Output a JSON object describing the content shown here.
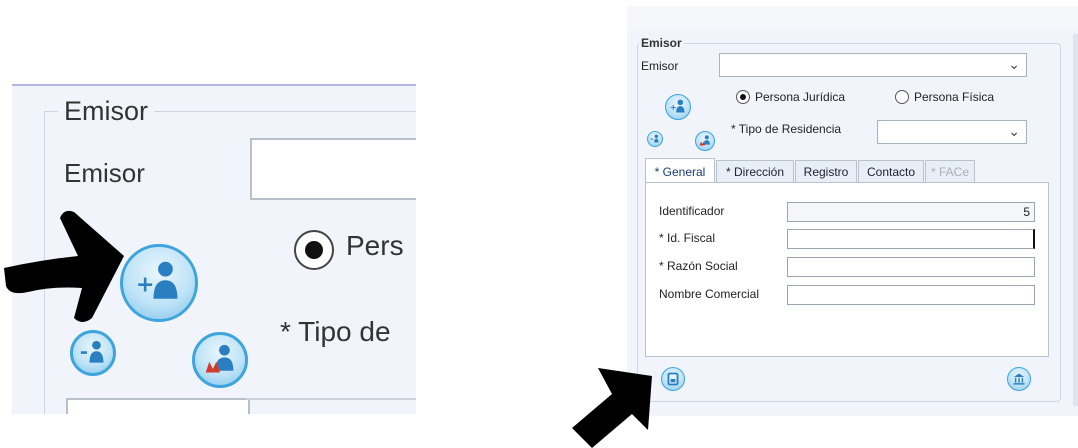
{
  "zoom": {
    "legend": "Emisor",
    "emisor_label": "Emisor",
    "radio_label": "Pers",
    "tipo_label": "* Tipo de"
  },
  "dialog": {
    "legend": "Emisor",
    "emisor_label": "Emisor",
    "emisor_value": "",
    "radio_juridica": "Persona Jurídica",
    "radio_fisica": "Persona Física",
    "selected_radio": "Persona Jurídica",
    "tipo_residencia_label": "* Tipo de Residencia",
    "tipo_residencia_value": "",
    "tabs": [
      {
        "label": "* General",
        "state": "active"
      },
      {
        "label": "* Dirección",
        "state": "normal"
      },
      {
        "label": "Registro",
        "state": "normal"
      },
      {
        "label": "Contacto",
        "state": "normal"
      },
      {
        "label": "* FACe",
        "state": "disabled"
      }
    ],
    "fields": {
      "identificador_label": "Identificador",
      "identificador_value": "5",
      "id_fiscal_label": "* Id. Fiscal",
      "id_fiscal_value": "",
      "razon_social_label": "* Razón Social",
      "razon_social_value": "",
      "nombre_comercial_label": "Nombre Comercial",
      "nombre_comercial_value": ""
    }
  },
  "icons": {
    "add_person": "add-person-icon",
    "person_info": "person-info-icon",
    "person_group": "person-group-icon",
    "save": "save-icon",
    "bank": "bank-icon"
  },
  "colors": {
    "icon_ring": "#3ea5dc",
    "panel_bg": "#f1f5fb",
    "arrow": "#000000"
  }
}
